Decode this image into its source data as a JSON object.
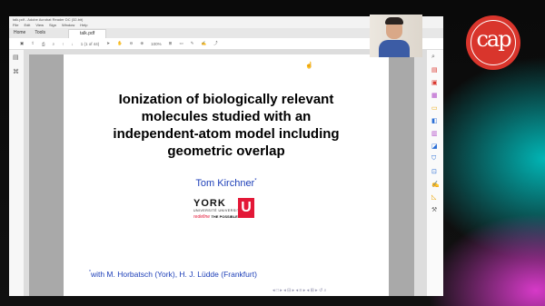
{
  "window": {
    "title": "talk.pdf - Adobe Acrobat Reader DC (32-bit)",
    "menu": [
      "File",
      "Edit",
      "View",
      "Sign",
      "Window",
      "Help"
    ],
    "tabs": {
      "home": "Home",
      "tools": "Tools",
      "document": "talk.pdf"
    },
    "toolbar": {
      "page_indicator": "1 (1 of 44)",
      "zoom": "100%"
    }
  },
  "slide": {
    "title_lines": [
      "Ionization of biologically relevant",
      "molecules studied with an",
      "independent-atom model including",
      "geometric overlap"
    ],
    "author": "Tom Kirchner",
    "author_mark": "*",
    "logo": {
      "wordmark": "YORK",
      "sub": "UNIVERSITÉ UNIVERSITY",
      "box": "U",
      "tagline": "redefine",
      "tagline2": "THE POSSIBLE."
    },
    "collab_mark": "*",
    "collaborators": "with M. Horbatsch (York), H. J. Lüdde (Frankfurt)"
  },
  "brand_logo": "cap",
  "colors": {
    "accent_blue": "#1d3fb8",
    "york_red": "#e31837",
    "logo_red": "#d9352c"
  }
}
